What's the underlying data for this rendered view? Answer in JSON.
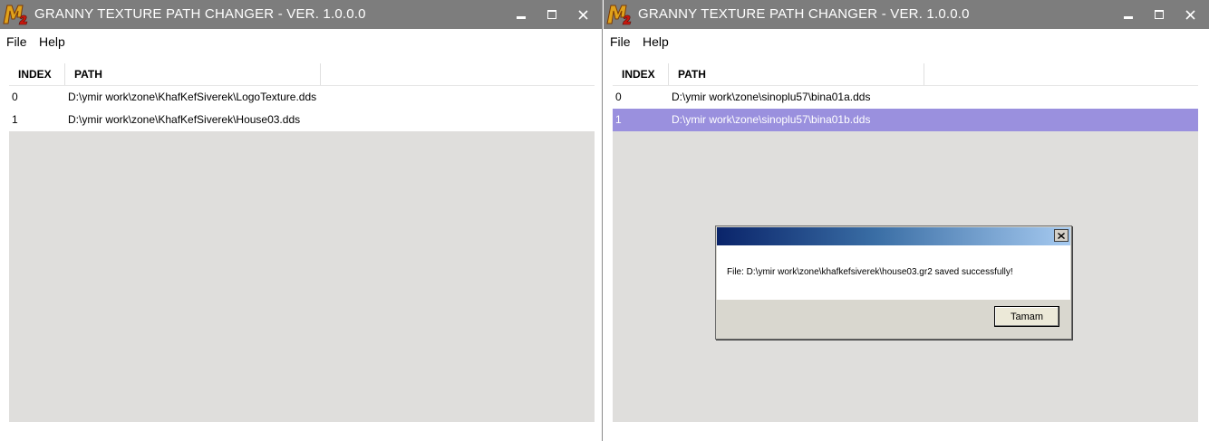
{
  "windows": [
    {
      "title": "GRANNY TEXTURE PATH CHANGER - VER. 1.0.0.0",
      "menu": [
        "File",
        "Help"
      ],
      "columns": {
        "index": "INDEX",
        "path": "PATH"
      },
      "rows": [
        {
          "index": "0",
          "path": "D:\\ymir work\\zone\\KhafKefSiverek\\LogoTexture.dds",
          "selected": false
        },
        {
          "index": "1",
          "path": "D:\\ymir work\\zone\\KhafKefSiverek\\House03.dds",
          "selected": false
        }
      ]
    },
    {
      "title": "GRANNY TEXTURE PATH CHANGER - VER. 1.0.0.0",
      "menu": [
        "File",
        "Help"
      ],
      "columns": {
        "index": "INDEX",
        "path": "PATH"
      },
      "rows": [
        {
          "index": "0",
          "path": "D:\\ymir work\\zone\\sinoplu57\\bina01a.dds",
          "selected": false
        },
        {
          "index": "1",
          "path": "D:\\ymir work\\zone\\sinoplu57\\bina01b.dds",
          "selected": true
        }
      ]
    }
  ],
  "dialog": {
    "message": "File: D:\\ymir work\\zone\\khafkefsiverek\\house03.gr2 saved successfully!",
    "ok_label": "Tamam"
  },
  "colors": {
    "titlebar": "#7d7d7d",
    "list_background": "#dfdedc",
    "selection": "#9a90de"
  },
  "icons": {
    "app": "m2-logo-icon",
    "minimize": "minimize-icon",
    "maximize": "maximize-icon",
    "close": "close-icon"
  }
}
